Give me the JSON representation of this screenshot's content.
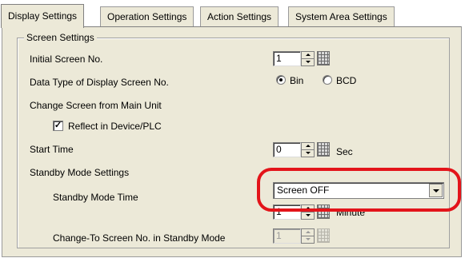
{
  "tabs": [
    {
      "label": "Display Settings",
      "active": true
    },
    {
      "label": "Operation Settings",
      "active": false
    },
    {
      "label": "Action Settings",
      "active": false
    },
    {
      "label": "System Area Settings",
      "active": false
    }
  ],
  "group": {
    "title": "Screen Settings"
  },
  "fields": {
    "initial_screen": {
      "label": "Initial Screen No.",
      "value": "1"
    },
    "data_type": {
      "label": "Data Type of Display Screen No.",
      "options": [
        "Bin",
        "BCD"
      ],
      "selected": "Bin"
    },
    "change_screen": {
      "label": "Change Screen from Main Unit"
    },
    "reflect": {
      "label": "Reflect in Device/PLC",
      "checked": true
    },
    "start_time": {
      "label": "Start Time",
      "value": "0",
      "unit": "Sec"
    },
    "standby_mode": {
      "label": "Standby Mode Settings",
      "value": "Screen OFF"
    },
    "standby_time": {
      "label": "Standby Mode Time",
      "value": "1",
      "unit": "Minute"
    },
    "change_to": {
      "label": "Change-To Screen No. in Standby Mode",
      "value": "1"
    }
  },
  "colors": {
    "highlight": "#e3141a",
    "panel": "#ece9d8"
  },
  "icons": {
    "keypad": "keypad-icon",
    "spin": "spin-arrows-icon",
    "dropdown": "chevron-down-icon"
  }
}
